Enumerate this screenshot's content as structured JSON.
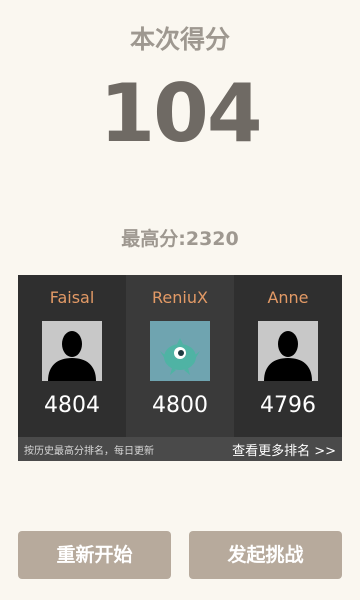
{
  "current_score": {
    "title": "本次得分",
    "value": "104"
  },
  "best_score": {
    "text": "最高分:2320"
  },
  "leaderboard": {
    "players": [
      {
        "name": "Faisal",
        "score": "4804",
        "avatar": "silhouette-avatar"
      },
      {
        "name": "ReniuX",
        "score": "4800",
        "avatar": "monster-avatar"
      },
      {
        "name": "Anne",
        "score": "4796",
        "avatar": "silhouette-avatar"
      }
    ],
    "note": "按历史最高分排名，每日更新",
    "more_link": "查看更多排名 >>"
  },
  "buttons": {
    "restart": "重新开始",
    "challenge": "发起挑战"
  },
  "colors": {
    "background": "#faf7f0",
    "board": "#2f2f2f",
    "player_name": "#e39a66",
    "button": "#b7aa9c"
  }
}
